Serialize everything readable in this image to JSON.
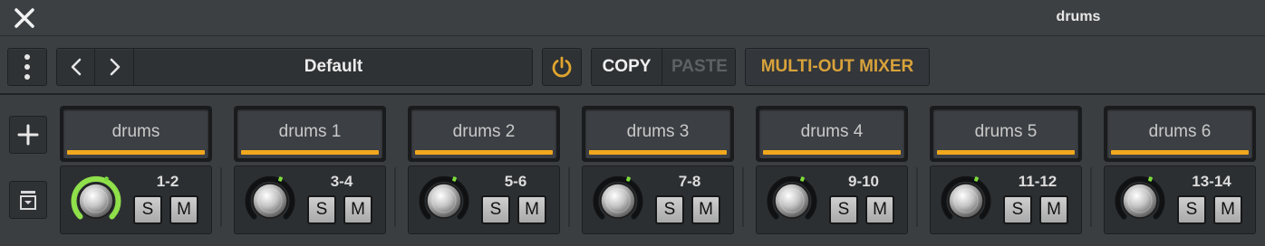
{
  "window": {
    "title": "drums"
  },
  "toolbar": {
    "preset_name": "Default",
    "copy_label": "COPY",
    "paste_label": "PASTE",
    "mixer_label": "MULTI-OUT MIXER"
  },
  "colors": {
    "accent": "#f1a81d",
    "mixer_text": "#d8a23b",
    "knob_active_ring": "#8fe04a",
    "knob_indicator": "#7ddc3c"
  },
  "channels": [
    {
      "name": "drums",
      "outputs": "1-2",
      "solo_label": "S",
      "mute_label": "M",
      "active": true
    },
    {
      "name": "drums 1",
      "outputs": "3-4",
      "solo_label": "S",
      "mute_label": "M",
      "active": false
    },
    {
      "name": "drums 2",
      "outputs": "5-6",
      "solo_label": "S",
      "mute_label": "M",
      "active": false
    },
    {
      "name": "drums 3",
      "outputs": "7-8",
      "solo_label": "S",
      "mute_label": "M",
      "active": false
    },
    {
      "name": "drums 4",
      "outputs": "9-10",
      "solo_label": "S",
      "mute_label": "M",
      "active": false
    },
    {
      "name": "drums 5",
      "outputs": "11-12",
      "solo_label": "S",
      "mute_label": "M",
      "active": false
    },
    {
      "name": "drums 6",
      "outputs": "13-14",
      "solo_label": "S",
      "mute_label": "M",
      "active": false
    }
  ]
}
